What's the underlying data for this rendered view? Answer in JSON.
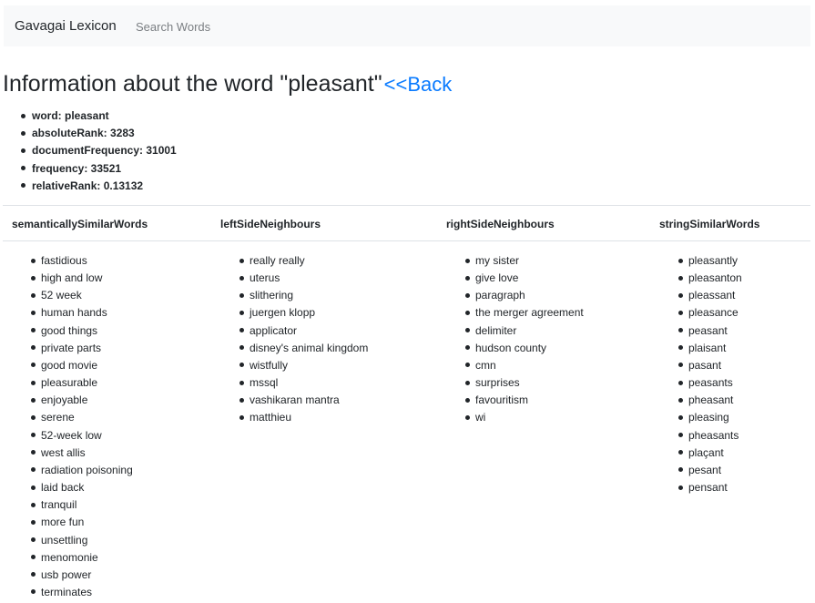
{
  "navbar": {
    "brand": "Gavagai Lexicon",
    "search_link": "Search Words"
  },
  "header": {
    "title": "Information about the word \"pleasant\"",
    "back_link": "<<Back"
  },
  "info": [
    "word: pleasant",
    "absoluteRank: 3283",
    "documentFrequency: 31001",
    "frequency: 33521",
    "relativeRank: 0.13132"
  ],
  "columns": [
    {
      "heading": "semanticallySimilarWords",
      "items": [
        "fastidious",
        "high and low",
        "52 week",
        "human hands",
        "good things",
        "private parts",
        "good movie",
        "pleasurable",
        "enjoyable",
        "serene",
        "52-week low",
        "west allis",
        "radiation poisoning",
        "laid back",
        "tranquil",
        "more fun",
        "unsettling",
        "menomonie",
        "usb power",
        "terminates"
      ]
    },
    {
      "heading": "leftSideNeighbours",
      "items": [
        "really really",
        "uterus",
        "slithering",
        "juergen klopp",
        "applicator",
        "disney's animal kingdom",
        "wistfully",
        "mssql",
        "vashikaran mantra",
        "matthieu"
      ]
    },
    {
      "heading": "rightSideNeighbours",
      "items": [
        "my sister",
        "give love",
        "paragraph",
        "the merger agreement",
        "delimiter",
        "hudson county",
        "cmn",
        "surprises",
        "favouritism",
        "wi"
      ]
    },
    {
      "heading": "stringSimilarWords",
      "items": [
        "pleasantly",
        "pleasanton",
        "pleassant",
        "pleasance",
        "peasant",
        "plaisant",
        "pasant",
        "peasants",
        "pheasant",
        "pleasing",
        "pheasants",
        "plaçant",
        "pesant",
        "pensant"
      ]
    }
  ]
}
